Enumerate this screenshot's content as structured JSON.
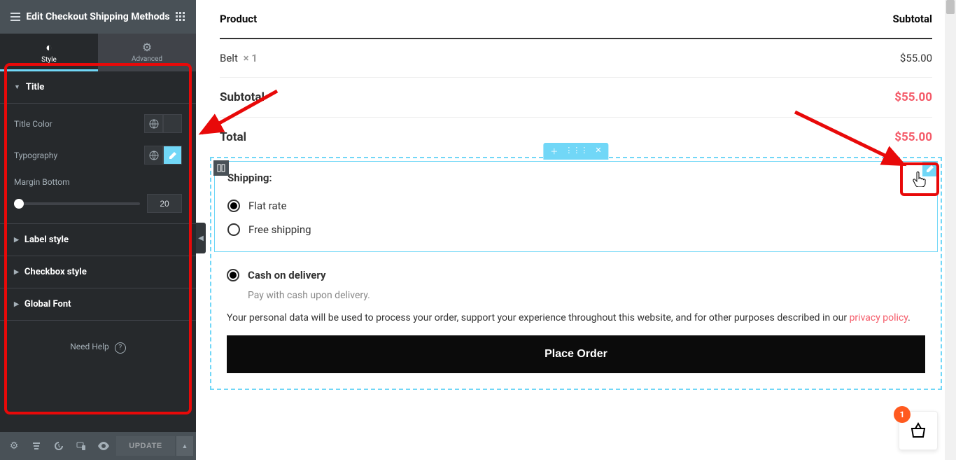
{
  "sidebar": {
    "title": "Edit Checkout Shipping Methods",
    "tabs": {
      "style": "Style",
      "advanced": "Advanced"
    },
    "sections": {
      "title_section": {
        "label": "Title",
        "title_color": "Title Color",
        "typography": "Typography",
        "margin_bottom": "Margin Bottom",
        "margin_value": "20"
      },
      "label_style": "Label style",
      "checkbox_style": "Checkbox style",
      "global_font": "Global Font"
    },
    "help": "Need Help",
    "update": "UPDATE"
  },
  "order": {
    "header_product": "Product",
    "header_subtotal": "Subtotal",
    "item_name": "Belt",
    "item_qty": "× 1",
    "item_price": "$55.00",
    "subtotal_label": "Subtotal",
    "subtotal_value": "$55.00",
    "total_label": "Total",
    "total_value": "$55.00"
  },
  "shipping": {
    "title": "Shipping:",
    "flat_rate": "Flat rate",
    "free_shipping": "Free shipping"
  },
  "payment": {
    "cod": "Cash on delivery",
    "cod_desc": "Pay with cash upon delivery."
  },
  "privacy": {
    "text": "Your personal data will be used to process your order, support your experience throughout this website, and for other purposes described in our ",
    "link": "privacy policy",
    "dot": "."
  },
  "place_order": "Place Order",
  "cart": {
    "count": "1"
  }
}
